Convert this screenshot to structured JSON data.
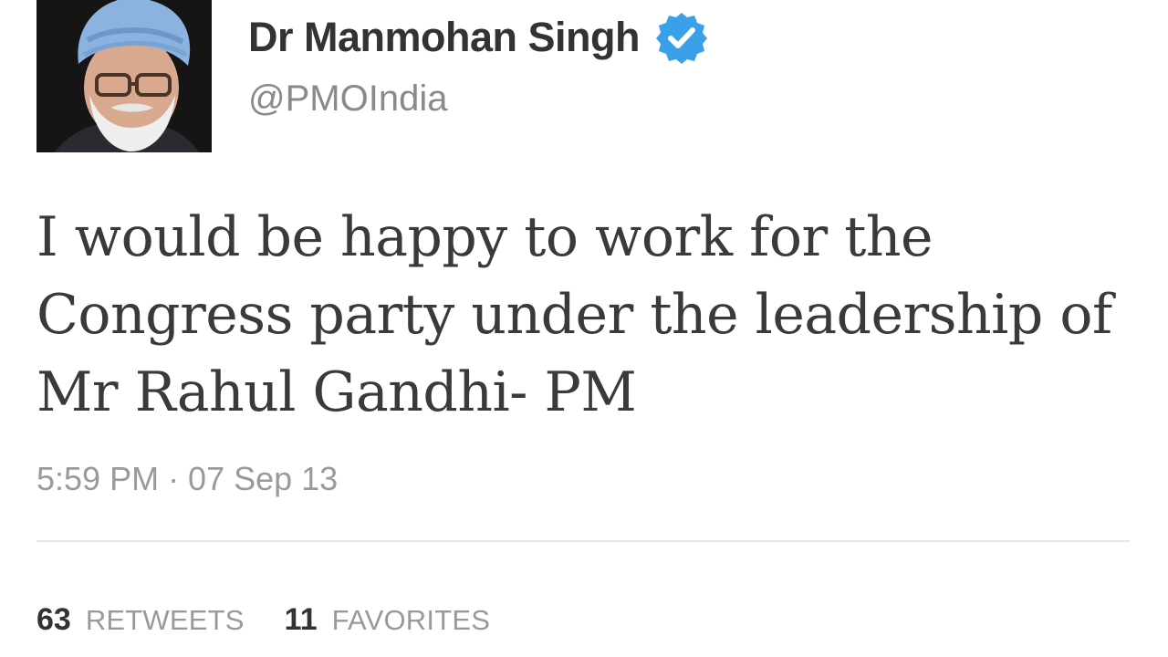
{
  "author": {
    "display_name": "Dr Manmohan Singh",
    "handle": "@PMOIndia",
    "verified": true,
    "avatar": "profile-photo"
  },
  "tweet": {
    "lines": [
      "I would be happy to work for the",
      "Congress party under the leadership of",
      "Mr Rahul Gandhi- PM"
    ],
    "timestamp": "5:59 PM · 07 Sep 13"
  },
  "stats": {
    "retweets_count": "63",
    "retweets_label": "RETWEETS",
    "favorites_count": "11",
    "favorites_label": "FAVORITES"
  },
  "colors": {
    "verified_badge": "#3aa0e8",
    "name_text": "#333333",
    "secondary_text": "#8a8a8a"
  }
}
